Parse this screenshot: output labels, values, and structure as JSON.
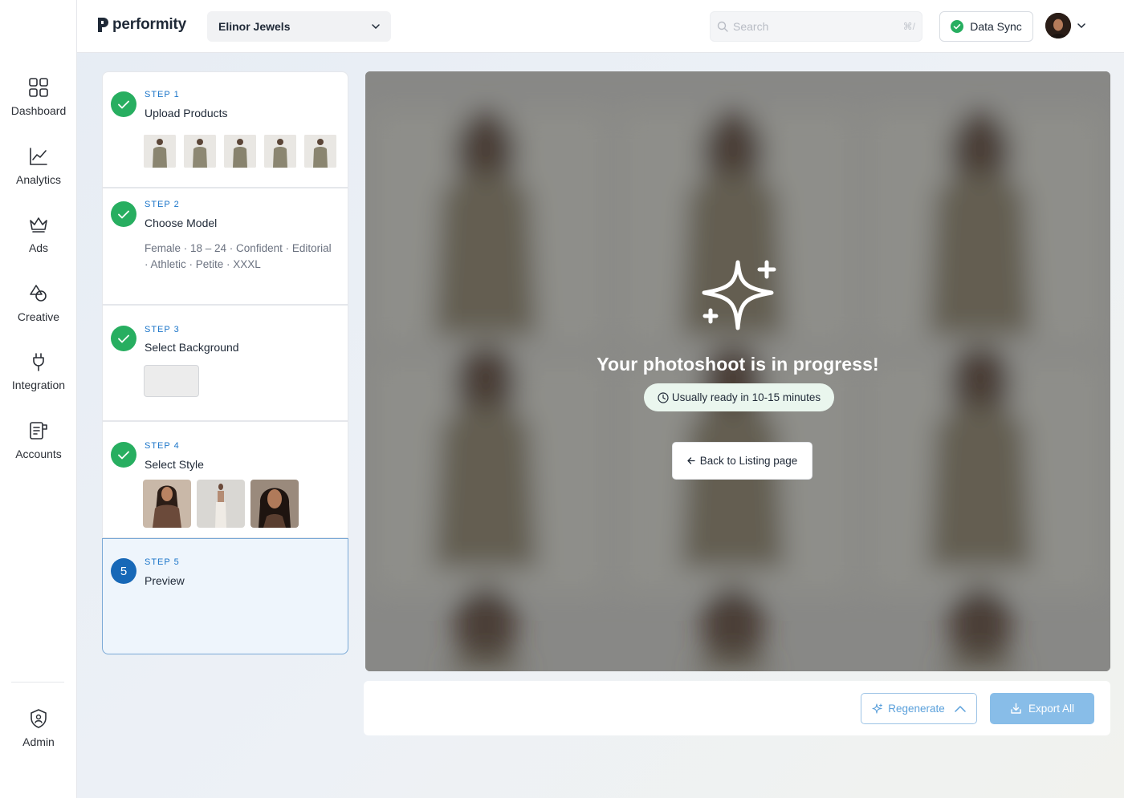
{
  "brand": {
    "name": "performity"
  },
  "header": {
    "store_name": "Elinor Jewels",
    "search_placeholder": "Search",
    "search_shortcut": "⌘/",
    "sync_label": "Data Sync"
  },
  "sidebar": {
    "items": [
      {
        "label": "Dashboard",
        "icon": "dashboard-icon"
      },
      {
        "label": "Analytics",
        "icon": "analytics-icon"
      },
      {
        "label": "Ads",
        "icon": "crown-icon"
      },
      {
        "label": "Creative",
        "icon": "shapes-icon"
      },
      {
        "label": "Integration",
        "icon": "plug-icon"
      },
      {
        "label": "Accounts",
        "icon": "accounts-icon"
      }
    ],
    "admin": {
      "label": "Admin",
      "icon": "shield-icon"
    }
  },
  "steps": [
    {
      "tag": "STEP  1",
      "title": "Upload Products",
      "status": "complete"
    },
    {
      "tag": "STEP  2",
      "title": "Choose Model",
      "status": "complete",
      "description": "Female · 18 – 24 · Confident · Editorial · Athletic · Petite · XXXL"
    },
    {
      "tag": "STEP  3",
      "title": "Select Background",
      "status": "complete"
    },
    {
      "tag": "STEP  4",
      "title": "Select Style",
      "status": "complete"
    },
    {
      "tag": "STEP  5",
      "title": "Preview",
      "status": "active",
      "number": "5"
    }
  ],
  "preview": {
    "title": "Your photoshoot is in progress!",
    "eta": "Usually ready in 10-15 minutes",
    "back_label": "Back to Listing page"
  },
  "actions": {
    "regenerate_label": "Regenerate",
    "export_label": "Export All"
  },
  "colors": {
    "accent": "#1b75c9",
    "success": "#27ae60",
    "export_bg": "#88bde8"
  }
}
